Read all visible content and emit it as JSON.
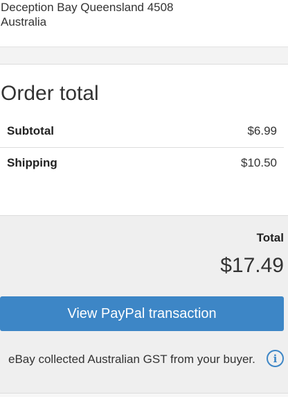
{
  "address": {
    "line1": "Deception Bay Queensland 4508",
    "line2": "Australia"
  },
  "order_total": {
    "heading": "Order total",
    "rows": [
      {
        "label": "Subtotal",
        "value": "$6.99"
      },
      {
        "label": "Shipping",
        "value": "$10.50"
      }
    ]
  },
  "summary": {
    "total_label": "Total",
    "total_value": "$17.49",
    "paypal_button_label": "View PayPal transaction",
    "gst_note": "eBay collected Australian GST from your buyer.",
    "info_icon_glyph": "i"
  },
  "colors": {
    "accent": "#3d86c6",
    "panel_background": "#efefef"
  },
  "icons": [
    "info-icon"
  ]
}
